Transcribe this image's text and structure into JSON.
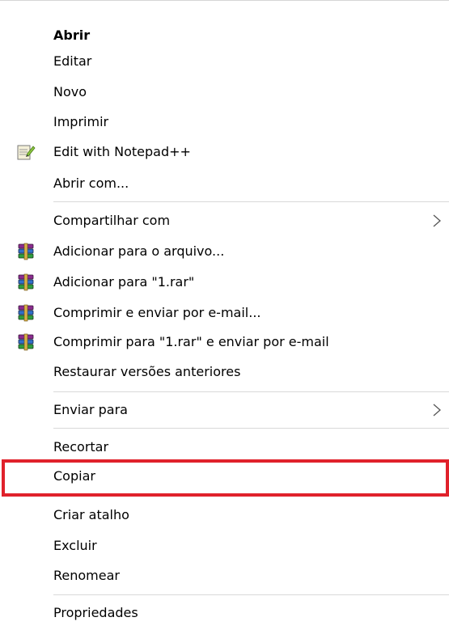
{
  "menu": {
    "items": [
      {
        "label": "Abrir",
        "bold": true
      },
      {
        "label": "Editar"
      },
      {
        "label": "Novo"
      },
      {
        "label": "Imprimir"
      },
      {
        "label": "Edit with Notepad++",
        "icon": "notepad-plus-plus-icon"
      },
      {
        "label": "Abrir com..."
      },
      {
        "label": "Compartilhar com",
        "submenu": true
      },
      {
        "label": "Adicionar para o arquivo...",
        "icon": "winrar-icon"
      },
      {
        "label": "Adicionar para \"1.rar\"",
        "icon": "winrar-icon"
      },
      {
        "label": "Comprimir e enviar por e-mail...",
        "icon": "winrar-icon"
      },
      {
        "label": "Comprimir para \"1.rar\" e enviar por e-mail",
        "icon": "winrar-icon"
      },
      {
        "label": "Restaurar versões anteriores"
      },
      {
        "label": "Enviar para",
        "submenu": true
      },
      {
        "label": "Recortar"
      },
      {
        "label": "Copiar",
        "highlighted": true
      },
      {
        "label": "Criar atalho"
      },
      {
        "label": "Excluir"
      },
      {
        "label": "Renomear"
      },
      {
        "label": "Propriedades"
      }
    ]
  },
  "colors": {
    "highlight_border": "#e0212b",
    "separator": "#d9d9d9"
  }
}
